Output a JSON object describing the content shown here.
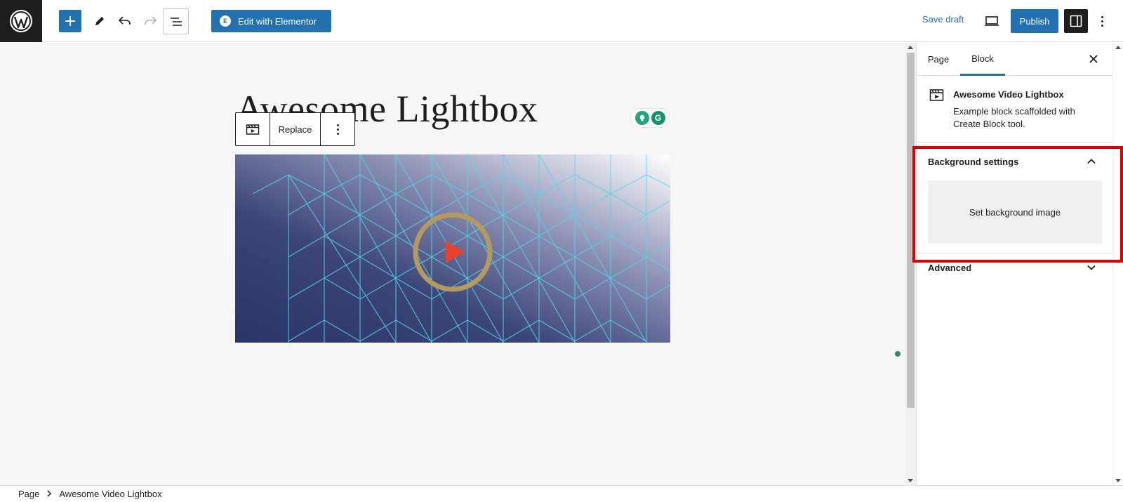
{
  "toolbar": {
    "elementor_label": "Edit with Elementor",
    "save_draft_label": "Save draft",
    "publish_label": "Publish"
  },
  "editor": {
    "title": "Awesome Lightbox",
    "block_toolbar": {
      "replace_label": "Replace"
    }
  },
  "sidebar": {
    "tabs": [
      {
        "label": "Page"
      },
      {
        "label": "Block"
      }
    ],
    "active_tab": "Block",
    "block_card": {
      "title": "Awesome Video Lightbox",
      "description": "Example block scaffolded with Create Block tool."
    },
    "panels": {
      "background": {
        "title": "Background settings",
        "button_label": "Set background image",
        "expanded": true
      },
      "advanced": {
        "title": "Advanced",
        "expanded": false
      }
    }
  },
  "breadcrumb": {
    "items": [
      "Page",
      "Awesome Video Lightbox"
    ]
  },
  "colors": {
    "accent": "#2271b1",
    "highlight": "#e00000",
    "play": "#e8412c",
    "ring": "#b59a5d"
  },
  "icons": [
    "wordpress-icon",
    "plus-icon",
    "pencil-icon",
    "undo-icon",
    "redo-icon",
    "list-view-icon",
    "desktop-preview-icon",
    "settings-sidebar-icon",
    "kebab-menu-icon",
    "video-block-icon",
    "close-icon",
    "chevron-up-icon",
    "chevron-down-icon",
    "grammarly-icon",
    "play-icon"
  ]
}
